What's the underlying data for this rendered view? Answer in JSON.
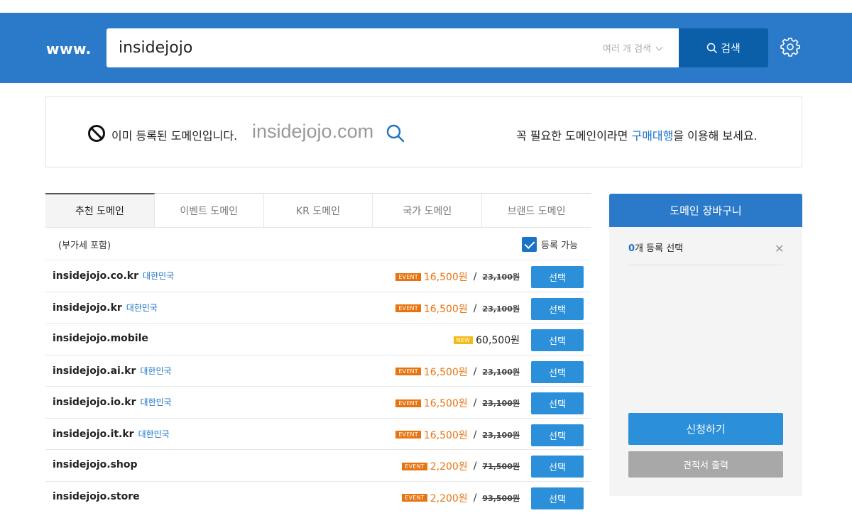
{
  "header": {
    "prefix": "www.",
    "search_value": "insidejojo",
    "multi_search_label": "여러 개 검색",
    "search_button_label": "검색"
  },
  "status": {
    "message": "이미 등록된 도메인입니다.",
    "domain": "insidejojo.com",
    "hint_before": "꼭 필요한 도메인이라면 ",
    "hint_link": "구매대행",
    "hint_after": "을 이용해 보세요."
  },
  "tabs": [
    {
      "label": "추천 도메인",
      "active": true
    },
    {
      "label": "이벤트 도메인",
      "active": false
    },
    {
      "label": "KR 도메인",
      "active": false
    },
    {
      "label": "국가 도메인",
      "active": false
    },
    {
      "label": "브랜드 도메인",
      "active": false
    }
  ],
  "list": {
    "vat_note": "(부가세 포함)",
    "available_filter_label": "등록 가능",
    "select_label": "선택",
    "rows": [
      {
        "domain": "insidejojo.co.kr",
        "country": "대한민국",
        "badge": "EVENT",
        "price": "16,500원",
        "original": "23,100원"
      },
      {
        "domain": "insidejojo.kr",
        "country": "대한민국",
        "badge": "EVENT",
        "price": "16,500원",
        "original": "23,100원"
      },
      {
        "domain": "insidejojo.mobile",
        "country": "",
        "badge": "NEW",
        "price": "60,500원",
        "original": ""
      },
      {
        "domain": "insidejojo.ai.kr",
        "country": "대한민국",
        "badge": "EVENT",
        "price": "16,500원",
        "original": "23,100원"
      },
      {
        "domain": "insidejojo.io.kr",
        "country": "대한민국",
        "badge": "EVENT",
        "price": "16,500원",
        "original": "23,100원"
      },
      {
        "domain": "insidejojo.it.kr",
        "country": "대한민국",
        "badge": "EVENT",
        "price": "16,500원",
        "original": "23,100원"
      },
      {
        "domain": "insidejojo.shop",
        "country": "",
        "badge": "EVENT",
        "price": "2,200원",
        "original": "71,500원"
      },
      {
        "domain": "insidejojo.store",
        "country": "",
        "badge": "EVENT",
        "price": "2,200원",
        "original": "93,500원"
      }
    ]
  },
  "cart": {
    "title": "도메인 장바구니",
    "count": "0",
    "count_suffix": "개 등록 선택",
    "apply_label": "신청하기",
    "quote_label": "견적서 출력"
  },
  "colors": {
    "brand_blue": "#2b7ac9",
    "button_blue": "#2b8fd9",
    "event_orange": "#e87411",
    "new_yellow": "#f5b915"
  }
}
